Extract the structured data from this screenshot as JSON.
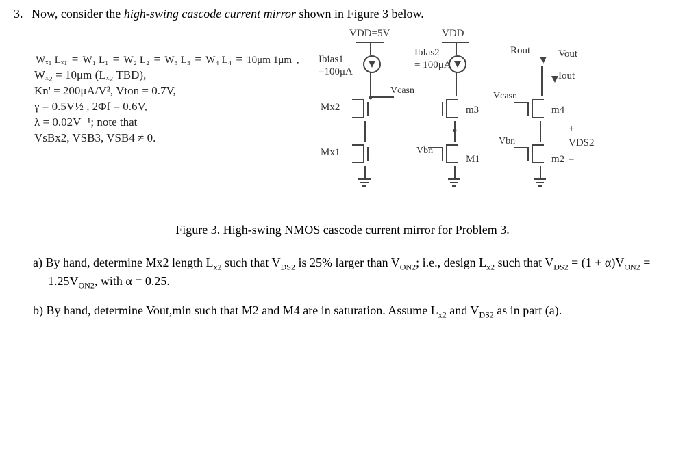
{
  "problem": {
    "number": "3.",
    "intro_before": "Now, consider the ",
    "intro_italic": "high-swing cascode current mirror",
    "intro_after": " shown in Figure 3 below."
  },
  "params": {
    "line1_lhs": "W",
    "line1": "Wₓ₁/Lₓ₁ = W₁/L₁ = W₂/L₂ = W₃/L₃ = W₄/L₄ = 10μm/1μm ,",
    "line2": "Wₓ₂ = 10μm (Lₓ₂ TBD),",
    "line3": "Kn' = 200μA/V², Vton = 0.7V,",
    "line4": "γ = 0.5V½ , 2Φf = 0.6V,",
    "line5": "λ = 0.02V⁻¹; note that",
    "line6": "VsBx2, VSB3, VSB4 ≠ 0."
  },
  "schematic": {
    "vdd_eq": "VDD=5V",
    "vdd": "VDD",
    "ibias1": "Ibias1",
    "ibias1_val": "=100μA",
    "iblas2": "Iblas2",
    "iblas2_val": "= 100μA",
    "mx2": "Mx2",
    "mx1": "Mx1",
    "m1": "M1",
    "m2": "m2",
    "m3": "m3",
    "m4": "m4",
    "vcasn_l": "Vcasn",
    "vcasn_r": "Vcasn",
    "vbn_l": "Vbn",
    "vbn_r": "Vbn",
    "rout": "Rout",
    "vout": "Vout",
    "iout": "Iout",
    "vds2_p": "+",
    "vds2": "VDS2",
    "vds2_m": "−"
  },
  "caption": "Figure 3.  High-swing NMOS cascode current mirror for Problem 3.",
  "parts": {
    "a_label": "a)",
    "a_text_1": "By hand, determine Mx2 length L",
    "a_text_2": " such that V",
    "a_text_3": " is 25% larger than V",
    "a_text_4": "; i.e., design L",
    "a_text_5": " such that V",
    "a_text_6": " = (1 + α)V",
    "a_text_7": " = 1.25V",
    "a_text_8": ", with α = 0.25.",
    "sub_x2": "x2",
    "sub_ds2": "DS2",
    "sub_on2": "ON2",
    "b_label": "b)",
    "b_text_1": "By hand, determine Vout,min such that M2 and M4 are in saturation. Assume L",
    "b_text_2": " and V",
    "b_text_3": " as in part (a)."
  }
}
